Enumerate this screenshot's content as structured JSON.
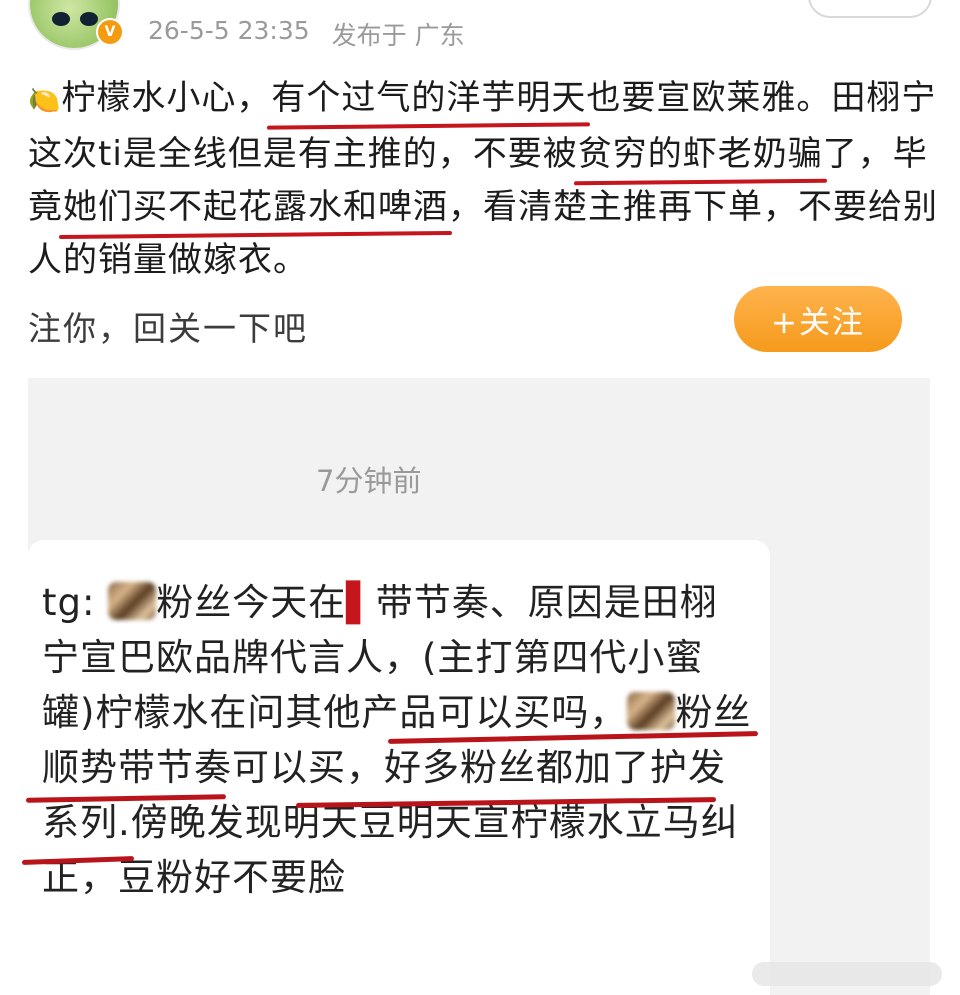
{
  "post": {
    "meta": {
      "time": "26-5-5 23:35",
      "location": "发布于 广东"
    },
    "text": {
      "emoji": "🍋",
      "p1": "柠檬水小心，",
      "u1": "有个过气的洋芋明天",
      "p2": "也要宣欧莱雅。田栩宁这次ti是全线但是有主推的，不要被",
      "u2": "贫穷的虾老奶骗",
      "p3": "了，毕竟",
      "u3": "她们买不起花露水和啤酒",
      "p4": "，看清楚主推再下单，不要给别人的销量做嫁衣。"
    },
    "reply_hint": "注你，回关一下吧",
    "follow_button": "+关注"
  },
  "chat": {
    "time": "7分钟前",
    "message": {
      "a": "tg: ",
      "b": "粉丝今天在",
      "book": "▌",
      "c": "带节奏、原因是田栩宁宣巴欧品牌代言人，(主打第四代小蜜罐)",
      "d": "柠檬水在问其他产品可以买吗，",
      "e": "粉丝顺势带节奏可以买，好多粉丝都加了护发系列.",
      "f": "傍晚发现明天",
      "f2": "豆明天宣",
      "f3": "柠檬水立马纠正，",
      "f4": "豆粉好不要脸"
    }
  },
  "colors": {
    "accent_orange": "#f59a1b",
    "underline_red": "#c4161c",
    "muted": "#9a9a9a"
  }
}
